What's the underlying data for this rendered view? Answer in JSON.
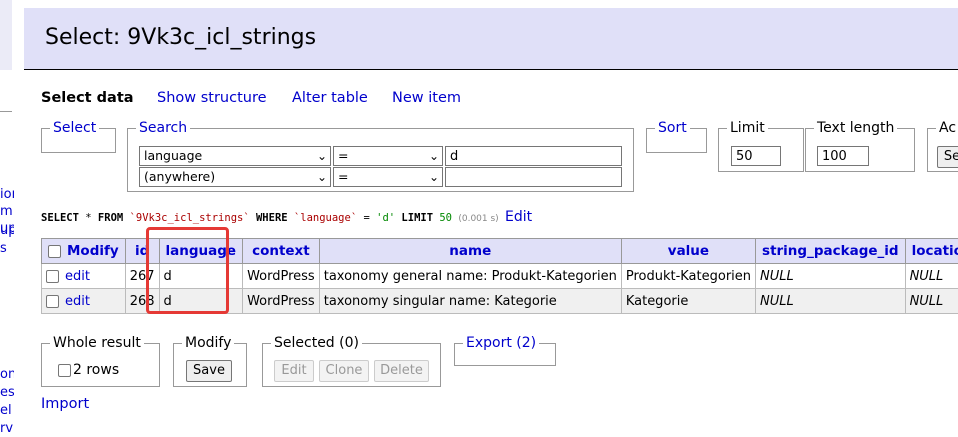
{
  "sidebar": {
    "fragments_top": [
      "ion",
      "m",
      "up",
      "ups",
      "s"
    ],
    "fragments_bottom": [
      "on",
      "es",
      "el",
      "rv"
    ]
  },
  "header": {
    "title": "Select: 9Vk3c_icl_strings"
  },
  "nav": {
    "select_data": "Select data",
    "show_structure": "Show structure",
    "alter_table": "Alter table",
    "new_item": "New item"
  },
  "filters": {
    "select_legend": "Select",
    "search_legend": "Search",
    "search_rows": [
      {
        "column": "language",
        "operator": "=",
        "value": "d"
      },
      {
        "column": "(anywhere)",
        "operator": "=",
        "value": ""
      }
    ],
    "sort_legend": "Sort",
    "limit_legend": "Limit",
    "limit_value": "50",
    "text_length_legend": "Text length",
    "text_length_value": "100",
    "action_legend": "Ac",
    "action_button": "Se"
  },
  "sql": {
    "select": "SELECT",
    "star": "*",
    "from": "FROM",
    "table": "`9Vk3c_icl_strings`",
    "where": "WHERE",
    "column": "`language`",
    "eq": "=",
    "value": "'d'",
    "limit": "LIMIT",
    "limit_num": "50",
    "time": "(0.001 s)",
    "edit_label": "Edit"
  },
  "table": {
    "modify_header": "Modify",
    "columns": [
      "id",
      "language",
      "context",
      "name",
      "value",
      "string_package_id",
      "location"
    ],
    "rows": [
      {
        "edit": "edit",
        "id": "267",
        "language": "d",
        "context": "WordPress",
        "name": "taxonomy general name: Produkt-Kategorien",
        "value": "Produkt-Kategorien",
        "string_package_id": "NULL",
        "location": "NULL"
      },
      {
        "edit": "edit",
        "id": "268",
        "language": "d",
        "context": "WordPress",
        "name": "taxonomy singular name: Kategorie",
        "value": "Kategorie",
        "string_package_id": "NULL",
        "location": "NULL"
      }
    ]
  },
  "footer": {
    "whole_result_legend": "Whole result",
    "rows_label": "2 rows",
    "modify_legend": "Modify",
    "save_button": "Save",
    "selected_legend": "Selected (0)",
    "edit_button": "Edit",
    "clone_button": "Clone",
    "delete_button": "Delete",
    "export_legend": "Export (2)",
    "import_link": "Import"
  },
  "colors": {
    "link": "#0000cc",
    "header_bg": "#e0e0f8",
    "highlight": "#e53935"
  }
}
